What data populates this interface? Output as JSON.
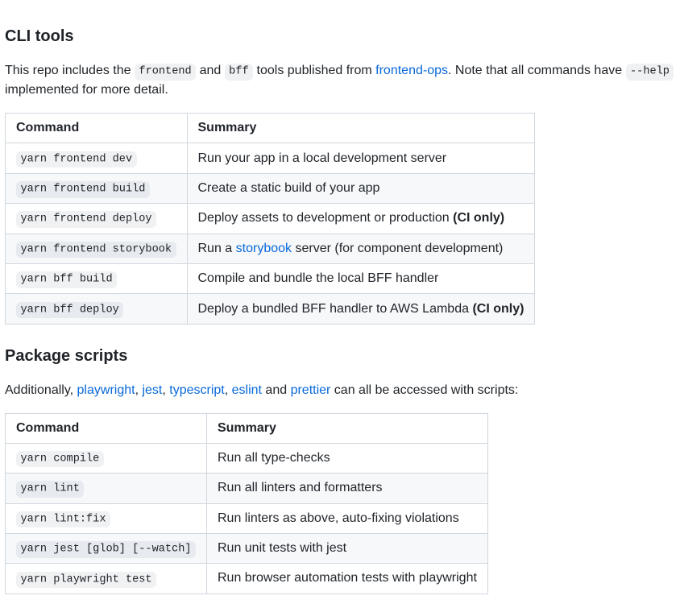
{
  "section1": {
    "heading": "CLI tools",
    "intro_parts": {
      "p1": "This repo includes the ",
      "code1": "frontend",
      "p2": " and ",
      "code2": "bff",
      "p3": " tools published from ",
      "link_text": "frontend-ops",
      "p4": ". Note that all commands have ",
      "code3": "--help",
      "p5": " implemented for more detail."
    },
    "table": {
      "headers": {
        "col1": "Command",
        "col2": "Summary"
      },
      "rows": [
        {
          "cmd": "yarn frontend dev",
          "summary": "Run your app in a local development server"
        },
        {
          "cmd": "yarn frontend build",
          "summary": "Create a static build of your app"
        },
        {
          "cmd": "yarn frontend deploy",
          "summary_pre": "Deploy assets to development or production ",
          "summary_bold": "(CI only)"
        },
        {
          "cmd": "yarn frontend storybook",
          "summary_pre": "Run a ",
          "summary_link": "storybook",
          "summary_post": " server (for component development)"
        },
        {
          "cmd": "yarn bff build",
          "summary": "Compile and bundle the local BFF handler"
        },
        {
          "cmd": "yarn bff deploy",
          "summary_pre": "Deploy a bundled BFF handler to AWS Lambda ",
          "summary_bold": "(CI only)"
        }
      ]
    }
  },
  "section2": {
    "heading": "Package scripts",
    "intro_parts": {
      "p1": "Additionally, ",
      "link1": "playwright",
      "sep1": ", ",
      "link2": "jest",
      "sep2": ", ",
      "link3": "typescript",
      "sep3": ", ",
      "link4": "eslint",
      "p2": " and ",
      "link5": "prettier",
      "p3": " can all be accessed with scripts:"
    },
    "table": {
      "headers": {
        "col1": "Command",
        "col2": "Summary"
      },
      "rows": [
        {
          "cmd": "yarn compile",
          "summary": "Run all type-checks"
        },
        {
          "cmd": "yarn lint",
          "summary": "Run all linters and formatters"
        },
        {
          "cmd": "yarn lint:fix",
          "summary": "Run linters as above, auto-fixing violations"
        },
        {
          "cmd": "yarn jest [glob] [--watch]",
          "summary": "Run unit tests with jest"
        },
        {
          "cmd": "yarn playwright test",
          "summary": "Run browser automation tests with playwright"
        }
      ]
    }
  }
}
